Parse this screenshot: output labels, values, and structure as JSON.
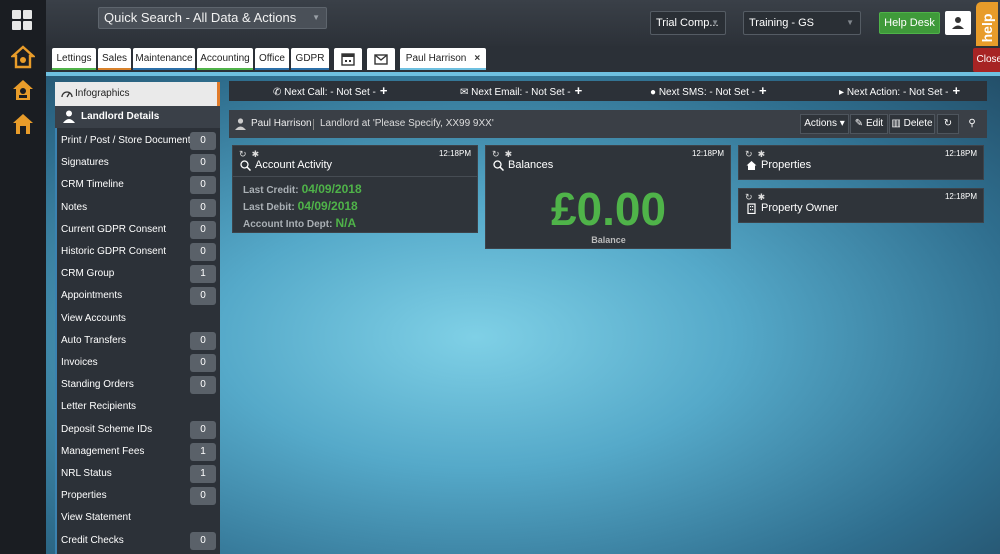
{
  "topbar": {
    "quick_search": "Quick Search - All Data & Actions",
    "company_select": "Trial Comp...",
    "training_select": "Training - GS",
    "help_desk": "Help Desk",
    "help_tab": "help"
  },
  "tabs": [
    {
      "label": "Lettings",
      "color": "#4fb349"
    },
    {
      "label": "Sales",
      "color": "#d9822b"
    },
    {
      "label": "Maintenance",
      "color": "#2b6fa8"
    },
    {
      "label": "Accounting",
      "color": "#4fb349"
    },
    {
      "label": "Office",
      "color": "#2b6fa8"
    },
    {
      "label": "GDPR",
      "color": "#2b6fa8"
    }
  ],
  "person_tab": {
    "label": "Paul Harrison",
    "close": "×"
  },
  "close_all": "Close All",
  "sidebar": {
    "header": "Infographics",
    "section": "Landlord Details",
    "items": [
      {
        "label": "Print / Post / Store Documents",
        "count": "0"
      },
      {
        "label": "Signatures",
        "count": "0"
      },
      {
        "label": "CRM Timeline",
        "count": "0"
      },
      {
        "label": "Notes",
        "count": "0"
      },
      {
        "label": "Current GDPR Consent",
        "count": "0"
      },
      {
        "label": "Historic GDPR Consent",
        "count": "0"
      },
      {
        "label": "CRM Group",
        "count": "1"
      },
      {
        "label": "Appointments",
        "count": "0"
      },
      {
        "label": "View Accounts",
        "count": ""
      },
      {
        "label": "Auto Transfers",
        "count": "0"
      },
      {
        "label": "Invoices",
        "count": "0"
      },
      {
        "label": "Standing Orders",
        "count": "0"
      },
      {
        "label": "Letter Recipients",
        "count": ""
      },
      {
        "label": "Deposit Scheme IDs",
        "count": "0"
      },
      {
        "label": "Management Fees",
        "count": "1"
      },
      {
        "label": "NRL Status",
        "count": "1"
      },
      {
        "label": "Properties",
        "count": "0"
      },
      {
        "label": "View Statement",
        "count": ""
      },
      {
        "label": "Credit Checks",
        "count": "0"
      }
    ]
  },
  "nextbar": {
    "call": "Next Call: - Not Set -",
    "email": "Next Email: - Not Set -",
    "sms": "Next SMS: - Not Set -",
    "action": "Next Action: - Not Set -",
    "plus": "+"
  },
  "personbar": {
    "name": "Paul Harrison",
    "description": "Landlord at 'Please Specify, XX99 9XX'",
    "actions": "Actions",
    "edit": "Edit",
    "delete": "Delete"
  },
  "widgets": {
    "account_activity": {
      "title": "Account Activity",
      "time": "12:18PM",
      "last_credit_label": "Last Credit:",
      "last_credit": "04/09/2018",
      "last_debit_label": "Last Debit:",
      "last_debit": "04/09/2018",
      "into_debt_label": "Account Into Dept:",
      "into_debt": "N/A"
    },
    "balances": {
      "title": "Balances",
      "time": "12:18PM",
      "amount": "£0.00",
      "label": "Balance"
    },
    "properties": {
      "title": "Properties",
      "time": "12:18PM"
    },
    "property_owner": {
      "title": "Property Owner",
      "time": "12:18PM"
    }
  }
}
